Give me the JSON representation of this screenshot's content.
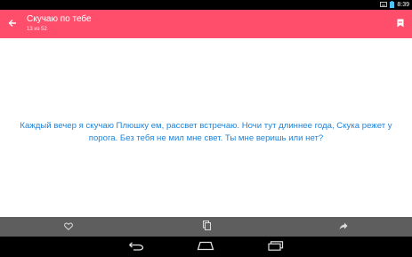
{
  "status_bar": {
    "time": "8:39",
    "icons": [
      "keyboard-icon",
      "battery-icon"
    ]
  },
  "app_bar": {
    "title": "Скучаю по тебе",
    "subtitle": "13 из 52",
    "background_color": "#fe4e6c",
    "icons": [
      "arrow-back-icon",
      "bookmark-icon"
    ]
  },
  "content": {
    "text": "Каждый вечер я скучаю Плюшку ем, рассвет встречаю. Ночи тут длиннее года, Скука режет у порога. Без тебя не мил мне свет. Ты мне веришь или нет?",
    "text_color": "#1f84d9"
  },
  "action_bar": {
    "icons": [
      "heart-icon",
      "copy-icon",
      "share-icon"
    ]
  },
  "nav_bar": {
    "icons": [
      "back-nav-icon",
      "home-nav-icon",
      "recents-nav-icon"
    ]
  }
}
